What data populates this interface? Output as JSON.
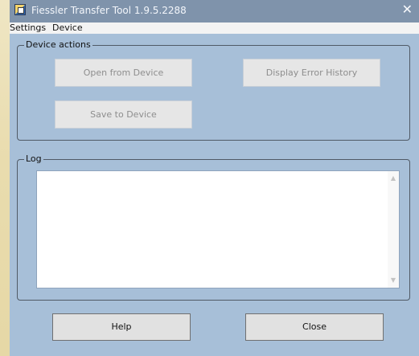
{
  "window": {
    "title": "Fiessler Transfer Tool 1.9.5.2288",
    "close_glyph": "✕"
  },
  "menu": {
    "items": [
      {
        "label": "Settings"
      },
      {
        "label": "Device"
      }
    ]
  },
  "device_actions": {
    "legend": "Device actions",
    "buttons": {
      "open": {
        "label": "Open from Device",
        "enabled": false
      },
      "history": {
        "label": "Display Error History",
        "enabled": false
      },
      "save": {
        "label": "Save to Device",
        "enabled": false
      }
    }
  },
  "log": {
    "legend": "Log",
    "text": "",
    "scroll_up_glyph": "▲",
    "scroll_down_glyph": "▼"
  },
  "footer": {
    "help_label": "Help",
    "close_label": "Close"
  },
  "colors": {
    "window_bg": "#a7bfd8",
    "titlebar_bg": "#7f93ab",
    "menubar_bg": "#f3f3f3",
    "button_bg": "#e1e1e1",
    "disabled_text": "#8e8e8e"
  },
  "icons": {
    "app": "app-icon",
    "close": "close-icon",
    "scroll_up": "scroll-up-icon",
    "scroll_down": "scroll-down-icon"
  }
}
